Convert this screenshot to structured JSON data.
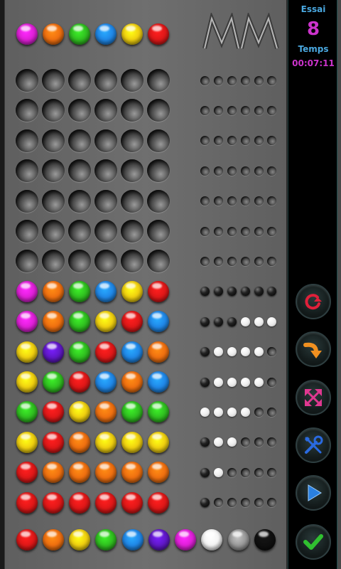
{
  "colors": {
    "magenta": "#e020d8",
    "orange": "#f07010",
    "green": "#30c020",
    "blue": "#2088e8",
    "yellow": "#f0d010",
    "red": "#e01818",
    "purple": "#6018c8",
    "white": "#f4f4f4",
    "gray": "#9a9a9a",
    "black": "#101010"
  },
  "secret_row": [
    "magenta",
    "orange",
    "green",
    "blue",
    "yellow",
    "red"
  ],
  "logo": {
    "icon": "mm-logo"
  },
  "empty_rows": 7,
  "guesses": [
    {
      "pegs": [
        "magenta",
        "orange",
        "green",
        "blue",
        "yellow",
        "red"
      ],
      "feedback": [
        "black",
        "black",
        "black",
        "black",
        "black",
        "black"
      ]
    },
    {
      "pegs": [
        "magenta",
        "orange",
        "green",
        "yellow",
        "red",
        "blue"
      ],
      "feedback": [
        "black",
        "black",
        "black",
        "white",
        "white",
        "white"
      ]
    },
    {
      "pegs": [
        "yellow",
        "purple",
        "green",
        "red",
        "blue",
        "orange"
      ],
      "feedback": [
        "black",
        "white",
        "white",
        "white",
        "white",
        "empty"
      ]
    },
    {
      "pegs": [
        "yellow",
        "green",
        "red",
        "blue",
        "orange",
        "blue"
      ],
      "feedback": [
        "black",
        "white",
        "white",
        "white",
        "white",
        "empty"
      ]
    },
    {
      "pegs": [
        "green",
        "red",
        "yellow",
        "orange",
        "green",
        "green"
      ],
      "feedback": [
        "white",
        "white",
        "white",
        "white",
        "empty",
        "empty"
      ]
    },
    {
      "pegs": [
        "yellow",
        "red",
        "orange",
        "yellow",
        "yellow",
        "yellow"
      ],
      "feedback": [
        "black",
        "white",
        "white",
        "empty",
        "empty",
        "empty"
      ]
    },
    {
      "pegs": [
        "red",
        "orange",
        "orange",
        "orange",
        "orange",
        "orange"
      ],
      "feedback": [
        "black",
        "white",
        "empty",
        "empty",
        "empty",
        "empty"
      ]
    },
    {
      "pegs": [
        "red",
        "red",
        "red",
        "red",
        "red",
        "red"
      ],
      "feedback": [
        "black",
        "empty",
        "empty",
        "empty",
        "empty",
        "empty"
      ]
    }
  ],
  "palette": [
    "red",
    "orange",
    "yellow",
    "green",
    "blue",
    "purple",
    "magenta",
    "white",
    "gray",
    "black"
  ],
  "side": {
    "trial_label": "Essai",
    "trial_value": "8",
    "time_label": "Temps",
    "time_value": "00:07:11"
  },
  "side_buttons": [
    {
      "name": "restart-button",
      "icon": "restart-icon",
      "color": "#e0203a"
    },
    {
      "name": "undo-button",
      "icon": "curved-arrow-icon",
      "color": "#f09020"
    },
    {
      "name": "fullscreen-button",
      "icon": "expand-arrows-icon",
      "color": "#e03890"
    },
    {
      "name": "settings-button",
      "icon": "tools-icon",
      "color": "#2a6ae0"
    },
    {
      "name": "play-button",
      "icon": "play-icon",
      "color": "#2a80e0"
    },
    {
      "name": "validate-button",
      "icon": "check-icon",
      "color": "#30c030"
    }
  ]
}
